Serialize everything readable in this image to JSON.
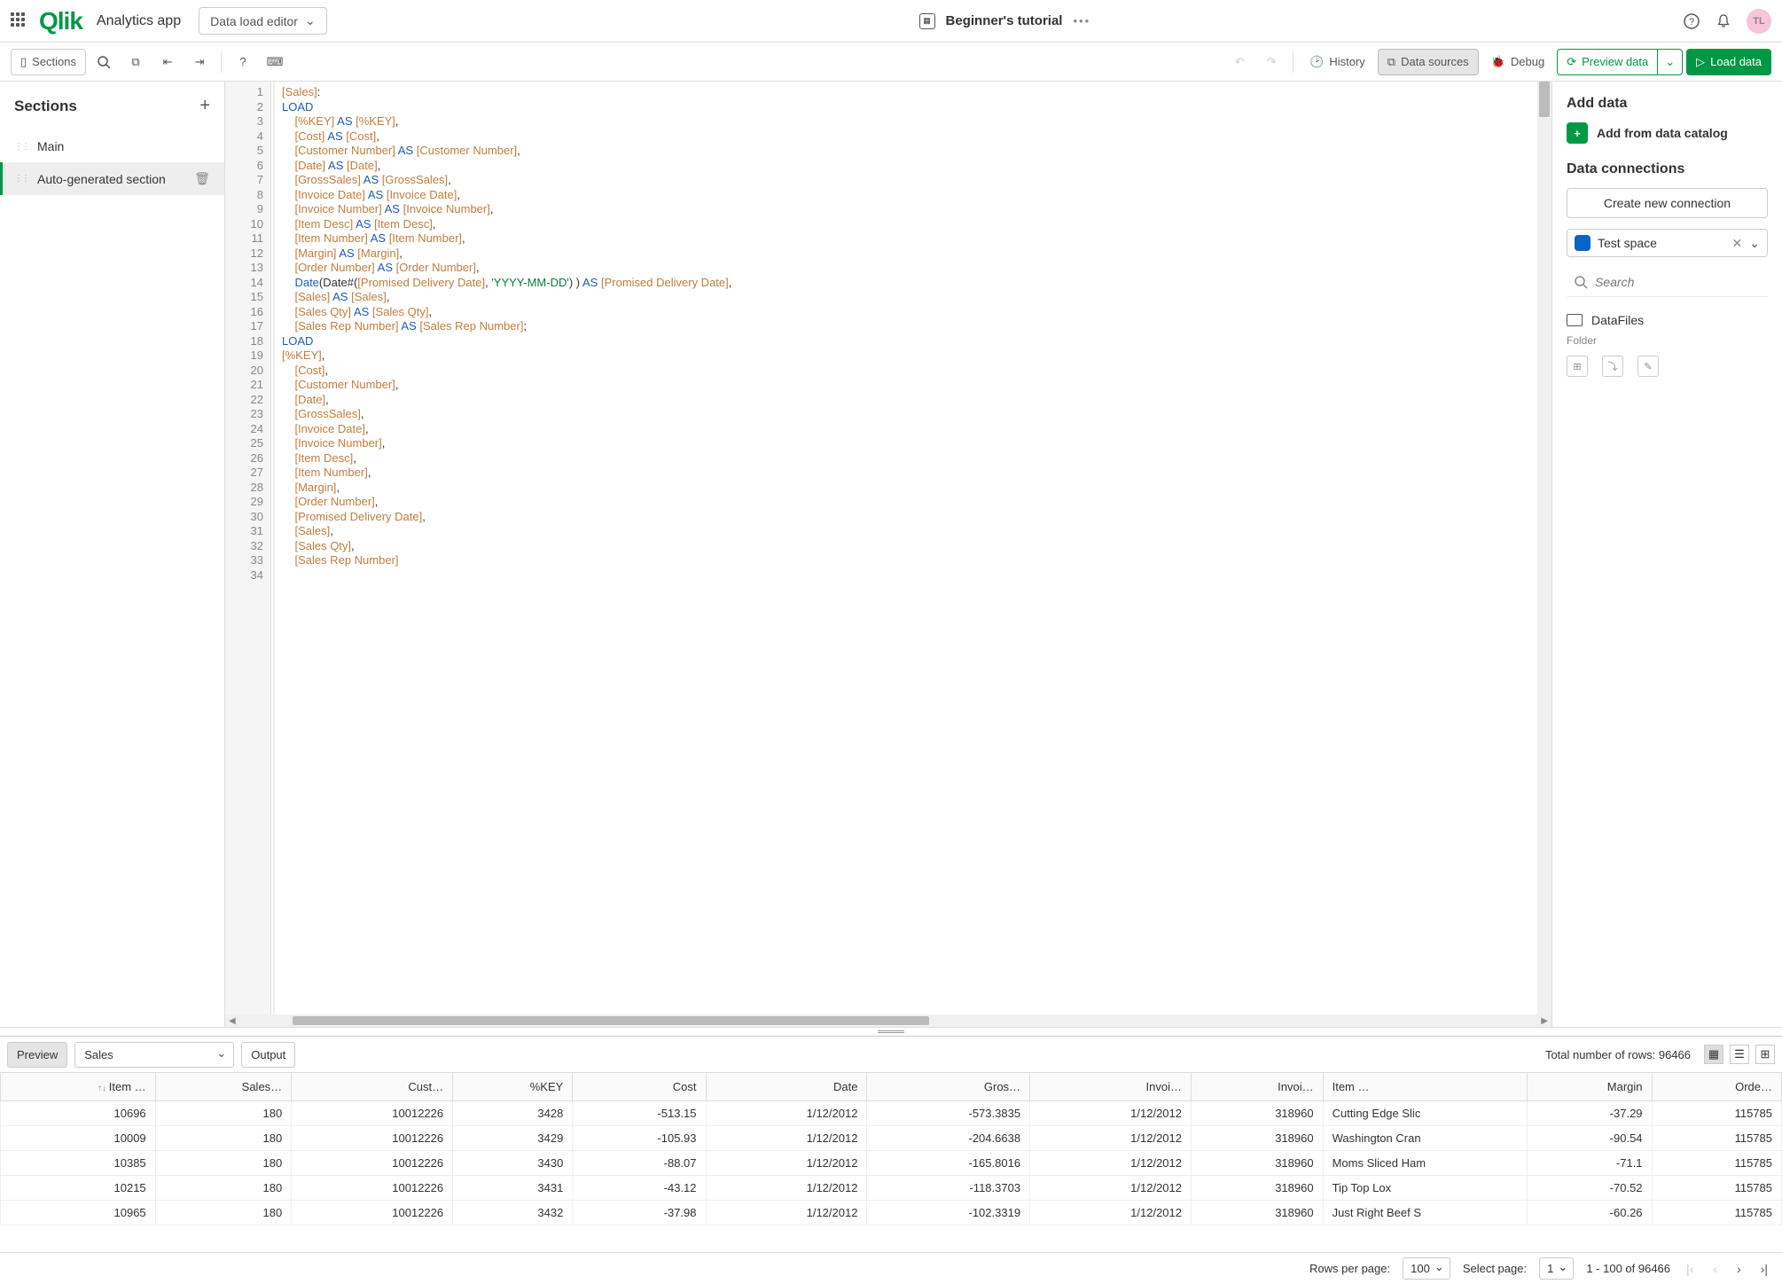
{
  "header": {
    "logo": "Qlik",
    "app_name": "Analytics app",
    "tool_selected": "Data load editor",
    "doc_title": "Beginner's tutorial",
    "avatar_initials": "TL"
  },
  "toolbar": {
    "sections": "Sections",
    "history": "History",
    "data_sources": "Data sources",
    "debug": "Debug",
    "preview_data": "Preview data",
    "load_data": "Load data"
  },
  "sections": {
    "title": "Sections",
    "items": [
      {
        "label": "Main",
        "active": false
      },
      {
        "label": "Auto-generated section",
        "active": true
      }
    ]
  },
  "code_lines": [
    "[Sales]:",
    "LOAD",
    "    [%KEY] AS [%KEY],",
    "    [Cost] AS [Cost],",
    "    [Customer Number] AS [Customer Number],",
    "    [Date] AS [Date],",
    "    [GrossSales] AS [GrossSales],",
    "    [Invoice Date] AS [Invoice Date],",
    "    [Invoice Number] AS [Invoice Number],",
    "    [Item Desc] AS [Item Desc],",
    "    [Item Number] AS [Item Number],",
    "    [Margin] AS [Margin],",
    "    [Order Number] AS [Order Number],",
    "    Date(Date#([Promised Delivery Date], 'YYYY-MM-DD') ) AS [Promised Delivery Date],",
    "    [Sales] AS [Sales],",
    "    [Sales Qty] AS [Sales Qty],",
    "    [Sales Rep Number] AS [Sales Rep Number];",
    "LOAD",
    "[%KEY],",
    "    [Cost],",
    "    [Customer Number],",
    "    [Date],",
    "    [GrossSales],",
    "    [Invoice Date],",
    "    [Invoice Number],",
    "    [Item Desc],",
    "    [Item Number],",
    "    [Margin],",
    "    [Order Number],",
    "    [Promised Delivery Date],",
    "    [Sales],",
    "    [Sales Qty],",
    "    [Sales Rep Number]",
    ""
  ],
  "right_panel": {
    "add_data_title": "Add data",
    "add_catalog": "Add from data catalog",
    "connections_title": "Data connections",
    "create_conn": "Create new connection",
    "space": "Test space",
    "search_placeholder": "Search",
    "folder": "DataFiles",
    "folder_sub": "Folder"
  },
  "preview": {
    "preview_btn": "Preview",
    "table_selected": "Sales",
    "output_btn": "Output",
    "total_rows": "Total number of rows: 96466",
    "columns": [
      "Item …",
      "Sales…",
      "Cust…",
      "%KEY",
      "Cost",
      "Date",
      "Gros…",
      "Invoi…",
      "Invoi…",
      "Item …",
      "Margin",
      "Orde…"
    ],
    "col_align": [
      "r",
      "r",
      "r",
      "r",
      "r",
      "r",
      "r",
      "r",
      "r",
      "l",
      "r",
      "r"
    ],
    "rows": [
      [
        "10696",
        "180",
        "10012226",
        "3428",
        "-513.15",
        "1/12/2012",
        "-573.3835",
        "1/12/2012",
        "318960",
        "Cutting Edge Slic",
        "-37.29",
        "115785"
      ],
      [
        "10009",
        "180",
        "10012226",
        "3429",
        "-105.93",
        "1/12/2012",
        "-204.6638",
        "1/12/2012",
        "318960",
        "Washington Cran",
        "-90.54",
        "115785"
      ],
      [
        "10385",
        "180",
        "10012226",
        "3430",
        "-88.07",
        "1/12/2012",
        "-165.8016",
        "1/12/2012",
        "318960",
        "Moms Sliced Ham",
        "-71.1",
        "115785"
      ],
      [
        "10215",
        "180",
        "10012226",
        "3431",
        "-43.12",
        "1/12/2012",
        "-118.3703",
        "1/12/2012",
        "318960",
        "Tip Top Lox",
        "-70.52",
        "115785"
      ],
      [
        "10965",
        "180",
        "10012226",
        "3432",
        "-37.98",
        "1/12/2012",
        "-102.3319",
        "1/12/2012",
        "318960",
        "Just Right Beef S",
        "-60.26",
        "115785"
      ]
    ]
  },
  "pager": {
    "rows_label": "Rows per page:",
    "rows_value": "100",
    "page_label": "Select page:",
    "page_value": "1",
    "range": "1 - 100 of 96466"
  }
}
